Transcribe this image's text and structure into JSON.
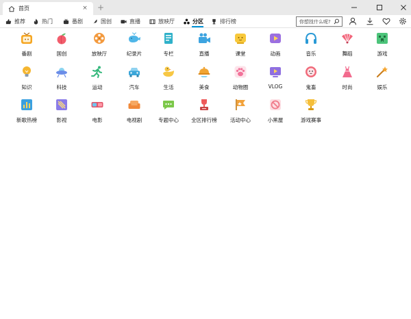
{
  "window": {
    "tab_title": "首页",
    "tab_close": "×",
    "new_tab": "+",
    "controls": [
      "minimize",
      "maximize",
      "close"
    ]
  },
  "nav": {
    "items": [
      {
        "label": "推荐",
        "icon": "thumbs-up-icon"
      },
      {
        "label": "热门",
        "icon": "fire-icon"
      },
      {
        "label": "番剧",
        "icon": "tv-icon"
      },
      {
        "label": "国创",
        "icon": "feather-icon"
      },
      {
        "label": "直播",
        "icon": "camera-icon"
      },
      {
        "label": "放映厅",
        "icon": "film-icon"
      },
      {
        "label": "分区",
        "icon": "category-icon",
        "active": true
      },
      {
        "label": "排行榜",
        "icon": "trophy-icon"
      }
    ]
  },
  "search": {
    "placeholder": "你想找什么呢?"
  },
  "categories": [
    {
      "label": "番剧",
      "icon": "tv-icon",
      "color": "#f5a623"
    },
    {
      "label": "国创",
      "icon": "peach-icon",
      "color": "#f25d6c"
    },
    {
      "label": "放映厅",
      "icon": "film-reel-icon",
      "color": "#f39a3e"
    },
    {
      "label": "纪录片",
      "icon": "whale-icon",
      "color": "#4fb6e8"
    },
    {
      "label": "专栏",
      "icon": "book-icon",
      "color": "#2fb1c9"
    },
    {
      "label": "直播",
      "icon": "video-camera-icon",
      "color": "#3da4e0"
    },
    {
      "label": "课堂",
      "icon": "classroom-icon",
      "color": "#f8c93c"
    },
    {
      "label": "动画",
      "icon": "play-icon",
      "color": "#9b6fe0"
    },
    {
      "label": "音乐",
      "icon": "headphones-icon",
      "color": "#2a9ad6"
    },
    {
      "label": "舞蹈",
      "icon": "fan-icon",
      "color": "#f2647a"
    },
    {
      "label": "游戏",
      "icon": "creeper-icon",
      "color": "#4cc47a"
    },
    {
      "label": "知识",
      "icon": "lightbulb-icon",
      "color": "#f5b631"
    },
    {
      "label": "科技",
      "icon": "ufo-icon",
      "color": "#6b8de8"
    },
    {
      "label": "运动",
      "icon": "runner-icon",
      "color": "#35b87c"
    },
    {
      "label": "汽车",
      "icon": "car-icon",
      "color": "#3ba6d9"
    },
    {
      "label": "生活",
      "icon": "duck-icon",
      "color": "#f7c744"
    },
    {
      "label": "美食",
      "icon": "dish-icon",
      "color": "#f0a534"
    },
    {
      "label": "动物圈",
      "icon": "paw-icon",
      "color": "#f2739a"
    },
    {
      "label": "VLOG",
      "icon": "vlog-icon",
      "color": "#8f6fe0"
    },
    {
      "label": "鬼畜",
      "icon": "ghost-face-icon",
      "color": "#f06a7a"
    },
    {
      "label": "时尚",
      "icon": "dress-icon",
      "color": "#f26a8d"
    },
    {
      "label": "娱乐",
      "icon": "magic-wand-icon",
      "color": "#f5a530"
    },
    {
      "label": "新歌热榜",
      "icon": "music-chart-icon",
      "color": "#3aa0e0"
    },
    {
      "label": "影视",
      "icon": "clapper-icon",
      "color": "#8a7be8"
    },
    {
      "label": "电影",
      "icon": "3d-glasses-icon",
      "color": "#e2566a"
    },
    {
      "label": "电视剧",
      "icon": "sofa-icon",
      "color": "#f0893a"
    },
    {
      "label": "专题中心",
      "icon": "chat-bubble-icon",
      "color": "#7cc84a"
    },
    {
      "label": "全区排行榜",
      "icon": "podium-trophy-icon",
      "color": "#ee5a5a"
    },
    {
      "label": "活动中心",
      "icon": "flag-icon",
      "color": "#f2a23a"
    },
    {
      "label": "小黑屋",
      "icon": "ban-icon",
      "color": "#f07a8a"
    },
    {
      "label": "游戏赛事",
      "icon": "cup-icon",
      "color": "#f5bf3a"
    }
  ]
}
